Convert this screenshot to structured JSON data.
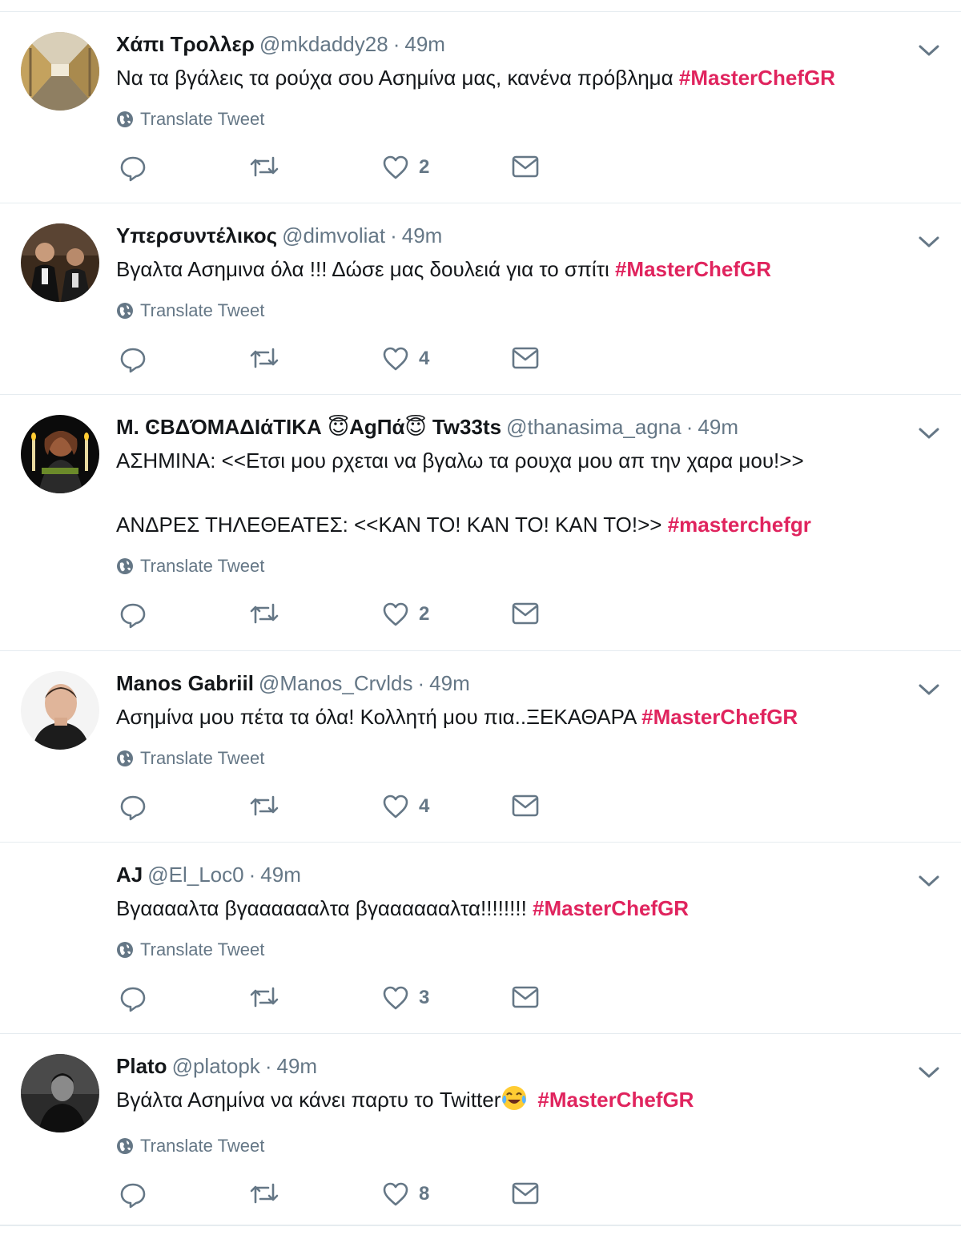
{
  "translate_label": "Translate Tweet",
  "colors": {
    "hashtag": "#e0245e",
    "meta": "#657786",
    "text": "#14171a",
    "divider": "#e6ecf0"
  },
  "tweets": [
    {
      "name": "Χάπι Τρολλερ",
      "handle": "@mkdaddy28",
      "separator": "·",
      "time": "49m",
      "lines": [
        {
          "text": "Να τα βγάλεις τα ρούχα σου Ασημίνα μας, κανένα πρόβλημα ",
          "tag": "#MasterChefGR"
        }
      ],
      "likes": "2",
      "avatar": "corridor-photo"
    },
    {
      "name": "Υπερσυντέλικος",
      "handle": "@dimvoliat",
      "separator": "·",
      "time": "49m",
      "lines": [
        {
          "text": "Βγαλτα Ασημινα όλα !!! Δώσε μας δουλειά για το σπίτι ",
          "tag": "#MasterChefGR"
        }
      ],
      "likes": "4",
      "avatar": "movie-still-photo"
    },
    {
      "name": "Μ. ϾΒΔΌΜΑΔΙάΤΙΚΑ 😇ΑgΠά😇 Tw33ts",
      "handle": "@thanasima_agna",
      "separator": "·",
      "time": "49m",
      "lines": [
        {
          "text": "ΑΣΗΜΙΝΑ: <<Ετσι μου ρχεται να βγαλω τα ρουχα μου απ την χαρα μου!>>",
          "tag": ""
        },
        {
          "text": "",
          "tag": ""
        },
        {
          "text": "ΑΝΔΡΕΣ ΤΗΛΕΘΕΑΤΕΣ: <<ΚΑΝ ΤΟ! ΚΑΝ ΤΟ! ΚΑΝ ΤΟ!>>  ",
          "tag": "#masterchefgr"
        }
      ],
      "likes": "2",
      "avatar": "candle-portrait-photo"
    },
    {
      "name": "Manos Gabriil",
      "handle": "@Manos_Crvlds",
      "separator": "·",
      "time": "49m",
      "lines": [
        {
          "text": "Ασημίνα μου πέτα τα όλα! Κολλητή μου πια..ΞΕΚΑΘΑΡΑ ",
          "tag": "#MasterChefGR"
        }
      ],
      "likes": "4",
      "avatar": "man-portrait-photo"
    },
    {
      "name": "AJ",
      "handle": "@El_Loc0",
      "separator": "·",
      "time": "49m",
      "lines": [
        {
          "text": "Βγααααλτα βγααααααλτα βγααααααλτα!!!!!!!! ",
          "tag": "#MasterChefGR"
        }
      ],
      "likes": "3",
      "avatar": ""
    },
    {
      "name": "Plato",
      "handle": "@platopk",
      "separator": "·",
      "time": "49m",
      "lines": [
        {
          "text": "Βγάλτα Ασημίνα να κάνει παρτυ το Twitter",
          "emoji": "tears-of-joy-icon",
          "tag": "#MasterChefGR"
        }
      ],
      "likes": "8",
      "avatar": "bw-portrait-photo"
    }
  ]
}
